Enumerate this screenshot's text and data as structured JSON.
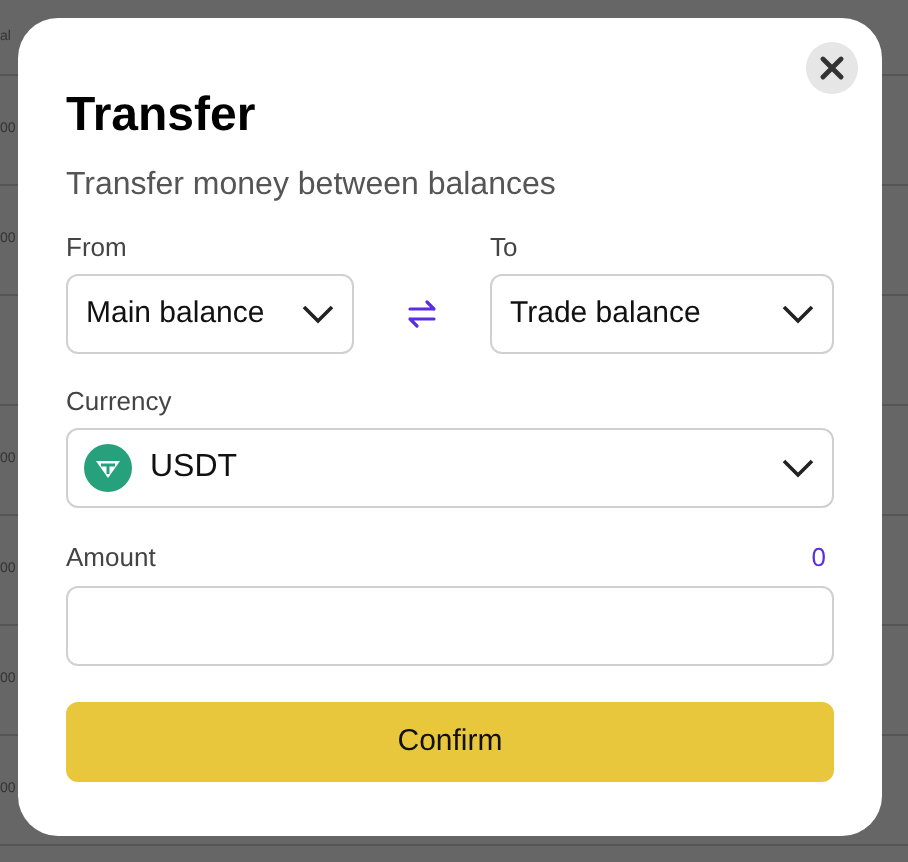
{
  "background": {
    "rows": [
      "al",
      "00",
      "00",
      "",
      "00",
      "00",
      "00",
      "00"
    ]
  },
  "dialog": {
    "title": "Transfer",
    "subtitle": "Transfer money between balances",
    "from": {
      "label": "From",
      "value": "Main balance"
    },
    "to": {
      "label": "To",
      "value": "Trade balance"
    },
    "currency": {
      "label": "Currency",
      "value": "USDT"
    },
    "amount": {
      "label": "Amount",
      "available": "0"
    },
    "confirm": "Confirm"
  }
}
